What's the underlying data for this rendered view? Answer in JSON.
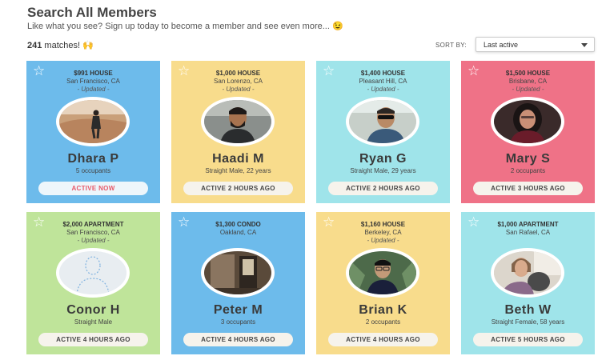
{
  "header": {
    "title": "Search All Members",
    "subtitle": "Like what you see? Sign up today to become a member and see even more... 😉",
    "count": "241",
    "count_suffix": "matches! 🙌",
    "sort_label": "SORT BY:",
    "sort_value": "Last active"
  },
  "colors": {
    "blue": "#6dbbeb",
    "yellow": "#f8dc8c",
    "teal": "#9fe4ea",
    "red": "#ef7287",
    "green": "#bfe49a",
    "active_now": "#e85a6a"
  },
  "cards": [
    {
      "price": "$991 HOUSE",
      "location": "San Francisco, CA",
      "updated": "- Updated -",
      "name": "Dhara P",
      "detail": "5 occupants",
      "status": "ACTIVE NOW",
      "photo_icon": "photo-desert-person"
    },
    {
      "price": "$1,000 HOUSE",
      "location": "San Lorenzo, CA",
      "updated": "- Updated -",
      "name": "Haadi M",
      "detail": "Straight Male, 22 years",
      "status": "ACTIVE 2 HOURS AGO",
      "photo_icon": "photo-man-beard"
    },
    {
      "price": "$1,400 HOUSE",
      "location": "Pleasant Hill, CA",
      "updated": "- Updated -",
      "name": "Ryan G",
      "detail": "Straight Male, 29 years",
      "status": "ACTIVE 2 HOURS AGO",
      "photo_icon": "photo-man-sunglasses"
    },
    {
      "price": "$1,500 HOUSE",
      "location": "Brisbane, CA",
      "updated": "- Updated -",
      "name": "Mary S",
      "detail": "2 occupants",
      "status": "ACTIVE 3 HOURS AGO",
      "photo_icon": "photo-woman-dark"
    },
    {
      "price": "$2,000 APARTMENT",
      "location": "San Francisco, CA",
      "updated": "- Updated -",
      "name": "Conor H",
      "detail": "Straight Male",
      "status": "ACTIVE 4 HOURS AGO",
      "photo_icon": "default-avatar-icon"
    },
    {
      "price": "$1,300 CONDO",
      "location": "Oakland, CA",
      "updated": "",
      "name": "Peter M",
      "detail": "3 occupants",
      "status": "ACTIVE 4 HOURS AGO",
      "photo_icon": "photo-room-interior"
    },
    {
      "price": "$1,160 HOUSE",
      "location": "Berkeley, CA",
      "updated": "- Updated -",
      "name": "Brian K",
      "detail": "2 occupants",
      "status": "ACTIVE 4 HOURS AGO",
      "photo_icon": "photo-man-glasses"
    },
    {
      "price": "$1,000 APARTMENT",
      "location": "San Rafael, CA",
      "updated": "",
      "name": "Beth W",
      "detail": "Straight Female, 58 years",
      "status": "ACTIVE 5 HOURS AGO",
      "photo_icon": "photo-woman-dog"
    }
  ]
}
